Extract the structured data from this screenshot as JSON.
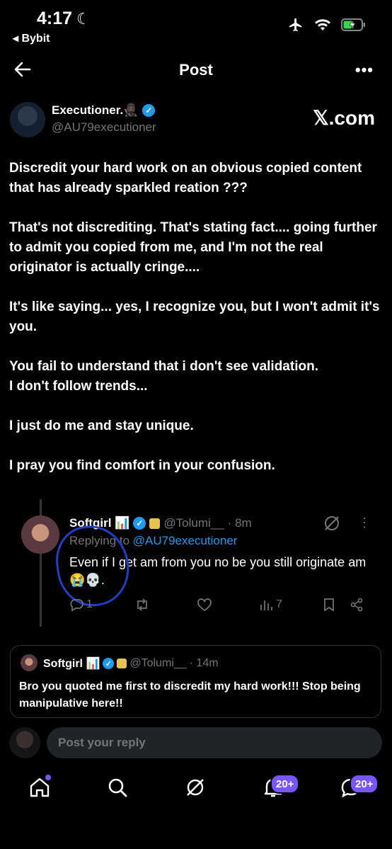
{
  "status_bar": {
    "time": "4:17",
    "back_app": "◂ Bybit"
  },
  "header": {
    "title": "Post",
    "more": "•••"
  },
  "author": {
    "name": "Executioner.🥷🏿",
    "handle": "@AU79executioner",
    "source": "𝕏.com"
  },
  "post": {
    "paragraphs": [
      "Discredit your hard work on an obvious copied content that has already sparkled reation ???",
      "That's not discrediting. That's stating fact.... going further to admit you copied from me, and I'm not the real originator is actually cringe....",
      "It's like saying... yes, I recognize you, but I won't admit it's you.",
      "You fail to understand that i don't see validation.\nI don't follow trends...",
      "I just do me and stay unique.",
      "I pray you find comfort in your confusion."
    ]
  },
  "reply": {
    "name": "Softgirl 📊",
    "handle": "@Tolumi__",
    "time": "· 8m",
    "replying_prefix": "Replying to ",
    "replying_to": "@AU79executioner",
    "text": "Even if I get am from you no be you still originate am 😭💀.",
    "reply_count": "1",
    "views": "7"
  },
  "quoted": {
    "name": "Softgirl 📊",
    "handle": "@Tolumi__",
    "time": "· 14m",
    "text": "Bro you quoted me first to discredit my hard work!!! Stop being manipulative here!!"
  },
  "reply_bar": {
    "placeholder": "Post your reply"
  },
  "tabbar": {
    "notif_badge": "20+",
    "msg_badge": "20+"
  },
  "colors": {
    "accent": "#1d9bf0",
    "badge": "#7856ff",
    "background": "#000000"
  }
}
